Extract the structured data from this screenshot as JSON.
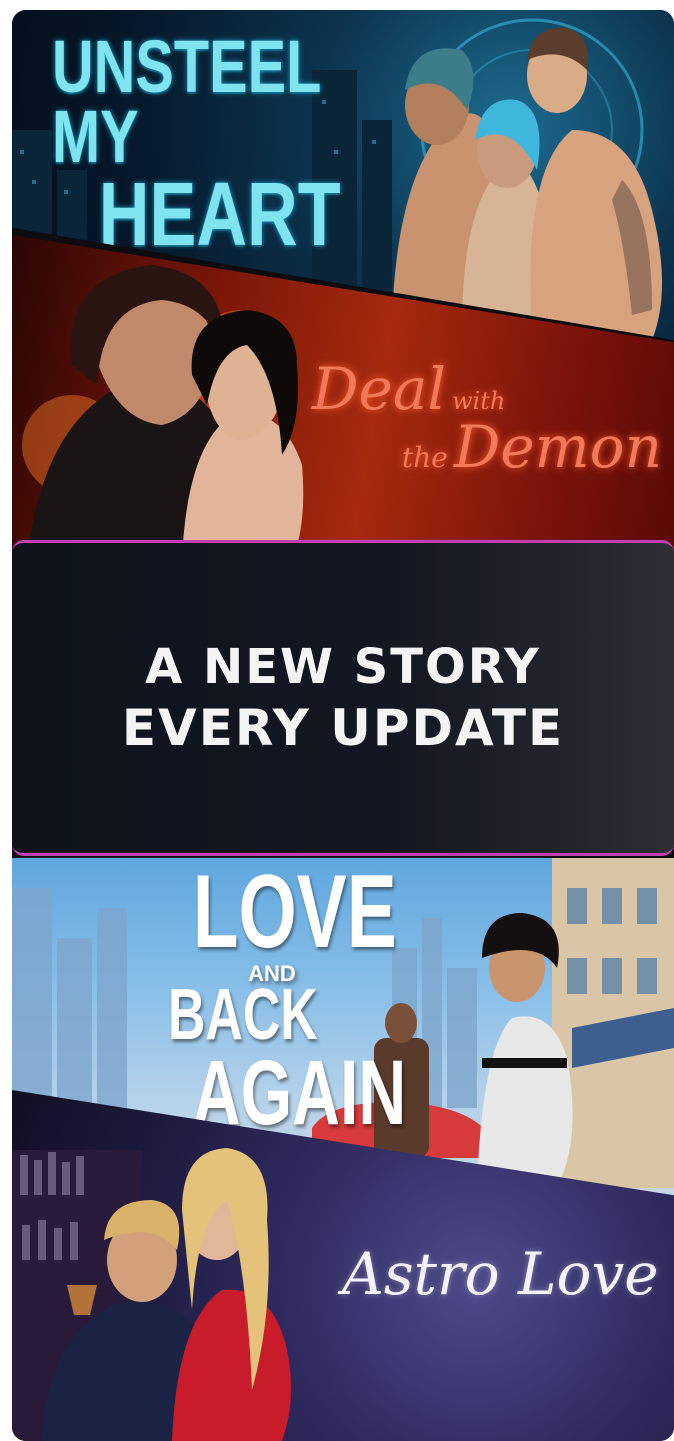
{
  "stories": [
    {
      "title_line1": "UNSTEEL MY",
      "title_line2": "HEART"
    },
    {
      "word1": "Deal",
      "word2": "with",
      "word3": "the",
      "word4": "Demon"
    },
    {
      "word1": "LOVE",
      "word2": "AND",
      "word3": "BACK",
      "word4": "AGAIN"
    },
    {
      "title": "Astro Love"
    }
  ],
  "banner": {
    "line1": "A NEW STORY",
    "line2": "EVERY UPDATE",
    "border_color": "#c23fb1"
  },
  "colors": {
    "unsteel_title": "#7fe3f0",
    "demon_title": "#f07a5a",
    "love_title": "#ffffff",
    "astro_title": "#f4f2ff"
  }
}
